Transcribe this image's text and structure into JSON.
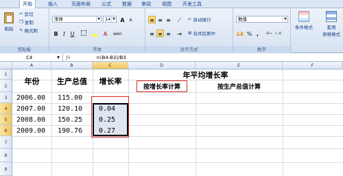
{
  "tabs": [
    "开始",
    "插入",
    "页面布局",
    "公式",
    "数据",
    "审阅",
    "视图",
    "开发工具"
  ],
  "ribbon": {
    "clipboard": {
      "paste": "粘贴",
      "cut": "剪切",
      "copy": "复制",
      "format_painter": "格式刷",
      "caption": "剪贴板"
    },
    "font": {
      "name": "宋体",
      "size": "14",
      "size_up": "A",
      "size_down": "A",
      "bold": "B",
      "italic": "I",
      "underline": "U",
      "wen": "wén",
      "caption": "字体"
    },
    "alignment": {
      "wrap": "自动换行",
      "merge": "合并后居中",
      "caption": "对齐方式"
    },
    "number": {
      "format": "数值",
      "percent": "%",
      "comma": ",",
      "caption": "数字"
    },
    "styles": {
      "conditional": "条件格式",
      "table_format_1": "套用",
      "table_format_2": "表格格式"
    }
  },
  "formula_bar": {
    "name_box": "C4",
    "fx": "fx",
    "formula": "=(B4-B3)/B3"
  },
  "columns": [
    "A",
    "B",
    "C",
    "D",
    "E",
    "F"
  ],
  "rows": [
    "1",
    "2",
    "3",
    "4",
    "5",
    "6",
    "7",
    "8",
    "9"
  ],
  "sheet": {
    "header_year": "年份",
    "header_value": "生产总值",
    "header_rate": "增长率",
    "title": "年平均增长率",
    "sub1": "按增长率计算",
    "sub2": "按生产总值计算",
    "years": [
      "2006.00",
      "2007.00",
      "2008.00",
      "2009.00"
    ],
    "values": [
      "115.00",
      "120.10",
      "150.25",
      "190.76"
    ],
    "rates": [
      "0.04",
      "0.25",
      "0.27"
    ]
  },
  "colors": {
    "red_box": "#e0281e",
    "accent": "#15428b"
  }
}
